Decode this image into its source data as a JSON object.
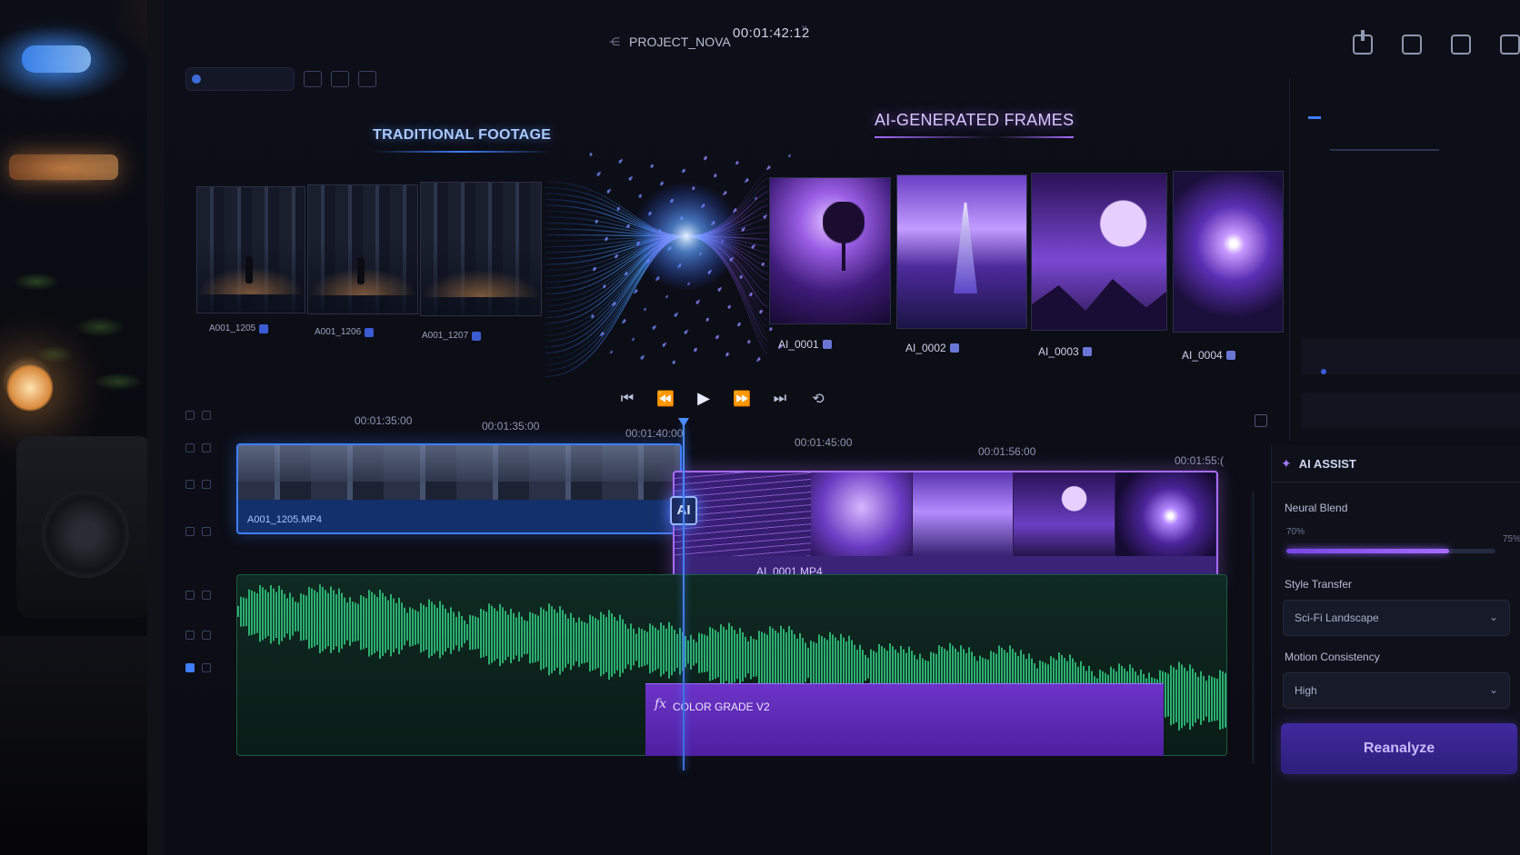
{
  "topbar": {
    "project_name": "PROJECT_NOVA",
    "project_glyph": "⋲",
    "timecode": "00:01:42:12",
    "timecode_chevron": "˅",
    "icons": [
      "share-icon",
      "export-icon",
      "layout-icon",
      "clipboard-icon"
    ]
  },
  "sections": {
    "traditional_title": "TRADITIONAL FOOTAGE",
    "ai_title": "AI-GENERATED FRAMES"
  },
  "traditional_clips": [
    {
      "label": "A001_1205"
    },
    {
      "label": "A001_1206"
    },
    {
      "label": "A001_1207"
    }
  ],
  "ai_frames": [
    {
      "label": "AI_0001"
    },
    {
      "label": "AI_0002"
    },
    {
      "label": "AI_0003"
    },
    {
      "label": "AI_0004"
    }
  ],
  "transport": {
    "go_start": "⏮",
    "step_back": "⏪",
    "play": "▶",
    "step_forward": "⏩",
    "go_end": "⏭",
    "loop": "⟲"
  },
  "ruler": {
    "labels": [
      "00:01:35:00",
      "00:01:35:00",
      "00:01:40:00",
      "00:01:45:00",
      "00:01:56:00",
      "00:01:55:("
    ]
  },
  "timeline": {
    "ai_chip": "AI",
    "video_clip_1": "A001_1205.MP4",
    "video_clip_2": "AI_0001.MP4",
    "effect_fx": "fx",
    "effect_name": "COLOR GRADE V2"
  },
  "assist": {
    "title": "AI ASSIST",
    "neural_blend_label": "Neural Blend",
    "neural_blend_min": "70%",
    "neural_blend_max": "75%",
    "neural_blend_value": 0.78,
    "style_transfer_label": "Style Transfer",
    "style_transfer_value": "Sci-Fi Landscape",
    "motion_label": "Motion Consistency",
    "motion_value": "High",
    "reanalyze_label": "Reanalyze",
    "accent": "#a66cff"
  },
  "colors": {
    "traditional_accent": "#3f7eff",
    "ai_accent": "#a86cff",
    "audio_wave": "#2fbf7a"
  }
}
